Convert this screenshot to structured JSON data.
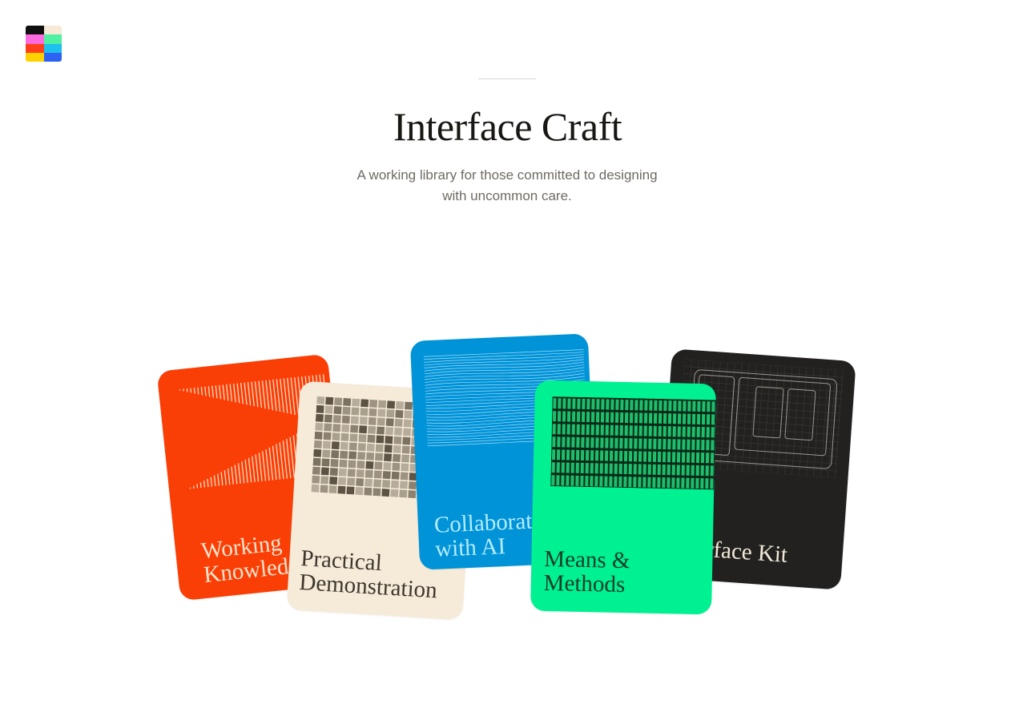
{
  "brand": {
    "logo_colors": [
      "#0f0f0f",
      "#f6ead7",
      "#ff6bdf",
      "#4ff0a1",
      "#ff3f1b",
      "#1ec0ee",
      "#ffd100",
      "#2d62f2"
    ]
  },
  "hero": {
    "title": "Interface Craft",
    "subtitle": "A working library for those committed to designing with uncommon care."
  },
  "cards": [
    {
      "label": "Working\nKnowledge",
      "bg": "#fa3f06",
      "text_color": "#fbe3cc",
      "art": "vertical-lines"
    },
    {
      "label": "Practical\nDemonstration",
      "bg": "#f6ebd9",
      "text_color": "#3e372e",
      "art": "pixel-grid"
    },
    {
      "label": "Collaborating\nwith AI",
      "bg": "#0093d8",
      "text_color": "#b3ecff",
      "art": "wave-lines"
    },
    {
      "label": "Means &\nMethods",
      "bg": "#00f192",
      "text_color": "#143d28",
      "art": "bar-matrix"
    },
    {
      "label": "Interface Kit",
      "bg": "#222120",
      "text_color": "#f3ead8",
      "art": "wireframe"
    }
  ]
}
